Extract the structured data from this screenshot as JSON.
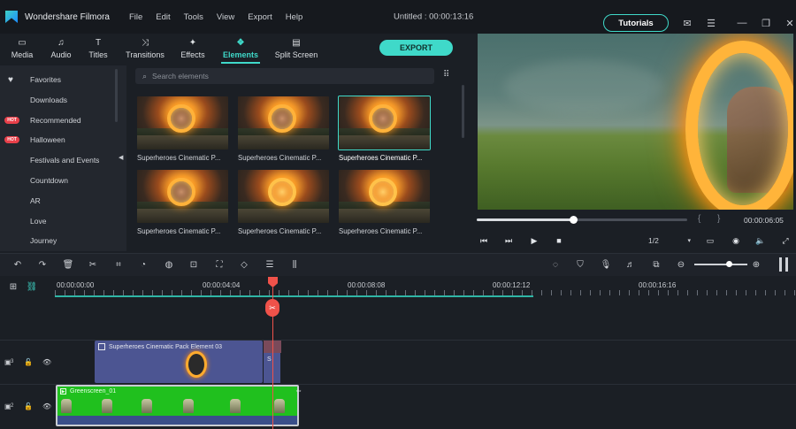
{
  "app": {
    "name": "Wondershare Filmora",
    "menu": [
      "File",
      "Edit",
      "Tools",
      "View",
      "Export",
      "Help"
    ],
    "project_title": "Untitled : 00:00:13:16",
    "tutorials_label": "Tutorials"
  },
  "toolbar": {
    "tabs": [
      {
        "label": "Media",
        "icon": "folder-icon"
      },
      {
        "label": "Audio",
        "icon": "music-note-icon"
      },
      {
        "label": "Titles",
        "icon": "text-T-icon"
      },
      {
        "label": "Transitions",
        "icon": "transition-icon"
      },
      {
        "label": "Effects",
        "icon": "sparkle-icon"
      },
      {
        "label": "Elements",
        "icon": "elements-icon"
      },
      {
        "label": "Split Screen",
        "icon": "split-screen-icon"
      }
    ],
    "active_tab": "Elements",
    "export_label": "EXPORT"
  },
  "sidebar": {
    "items": [
      {
        "label": "Favorites",
        "badge": "heart"
      },
      {
        "label": "Downloads",
        "badge": ""
      },
      {
        "label": "Recommended",
        "badge": "HOT"
      },
      {
        "label": "Halloween",
        "badge": "HOT"
      },
      {
        "label": "Festivals and Events",
        "badge": ""
      },
      {
        "label": "Countdown",
        "badge": ""
      },
      {
        "label": "AR",
        "badge": ""
      },
      {
        "label": "Love",
        "badge": ""
      },
      {
        "label": "Journey",
        "badge": ""
      }
    ]
  },
  "elements": {
    "search_placeholder": "Search elements",
    "cards": [
      {
        "name": "Superheroes Cinematic P...",
        "selected": false
      },
      {
        "name": "Superheroes Cinematic P...",
        "selected": false
      },
      {
        "name": "Superheroes Cinematic P...",
        "selected": true
      },
      {
        "name": "Superheroes Cinematic P...",
        "selected": false
      },
      {
        "name": "Superheroes Cinematic P...",
        "selected": false
      },
      {
        "name": "Superheroes Cinematic P...",
        "selected": false
      }
    ]
  },
  "preview": {
    "time": "00:00:06:05",
    "progress_fraction": 0.46,
    "quality": "1/2",
    "braces": [
      "{",
      "}"
    ]
  },
  "timeline": {
    "ruler_labels": [
      "00:00:00:00",
      "00:00:04:04",
      "00:00:08:08",
      "00:00:12:12",
      "00:00:16:16"
    ],
    "tracks": [
      {
        "number": "3",
        "clips": [
          {
            "title": "Superheroes Cinematic Pack Element 03"
          },
          {
            "title": "S"
          }
        ]
      },
      {
        "number": "2",
        "clips": [
          {
            "title": "Greenscreen_01"
          }
        ]
      }
    ],
    "zoom_fraction": 0.6
  },
  "colors": {
    "accent": "#3fd9c9",
    "hot_badge": "#e8404a",
    "playhead": "#f0524a",
    "element_clip": "#4c5592",
    "greenscreen_clip": "#20c01e"
  }
}
